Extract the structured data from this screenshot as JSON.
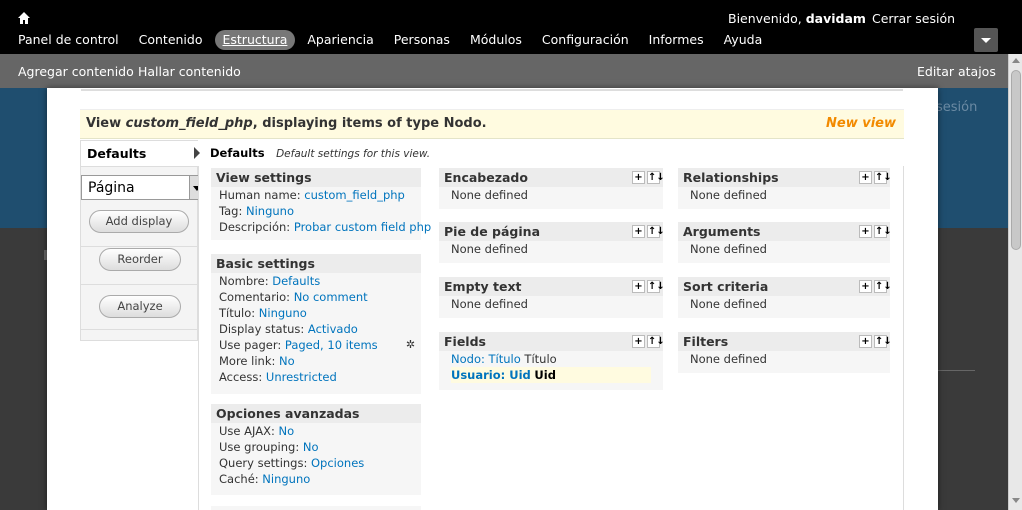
{
  "toolbar": {
    "menu": [
      "Panel de control",
      "Contenido",
      "Estructura",
      "Apariencia",
      "Personas",
      "Módulos",
      "Configuración",
      "Informes",
      "Ayuda"
    ],
    "welcome_prefix": "Bienvenido,",
    "username": "davidam",
    "logout": "Cerrar sesión"
  },
  "shortcuts": {
    "add": "Agregar contenido",
    "find": "Hallar contenido",
    "edit": "Editar atajos"
  },
  "background": {
    "right_text": "sesión"
  },
  "view_header": {
    "prefix": "View",
    "name": "custom_field_php",
    "suffix": ", displaying items of type Nodo.",
    "new_view": "New view"
  },
  "left": {
    "tab_defaults": "Defaults",
    "display_select": "Página",
    "add_display": "Add display",
    "reorder": "Reorder",
    "analyze": "Analyze"
  },
  "display_header": {
    "title": "Defaults",
    "desc": "Default settings for this view."
  },
  "view_settings": {
    "title": "View settings",
    "human_name_label": "Human name:",
    "human_name": "custom_field_php",
    "tag_label": "Tag:",
    "tag": "Ninguno",
    "desc_label": "Descripción:",
    "desc": "Probar custom field php"
  },
  "basic_settings": {
    "title": "Basic settings",
    "rows": [
      {
        "label": "Nombre:",
        "value": "Defaults"
      },
      {
        "label": "Comentario:",
        "value": "No comment"
      },
      {
        "label": "Título:",
        "value": "Ninguno"
      },
      {
        "label": "Display status:",
        "value": "Activado"
      },
      {
        "label": "Use pager:",
        "value": "Paged, 10 items"
      },
      {
        "label": "More link:",
        "value": "No"
      },
      {
        "label": "Access:",
        "value": "Unrestricted"
      }
    ]
  },
  "advanced": {
    "title": "Opciones avanzadas",
    "rows": [
      {
        "label": "Use AJAX:",
        "value": "No"
      },
      {
        "label": "Use grouping:",
        "value": "No"
      },
      {
        "label": "Query settings:",
        "value": "Opciones"
      },
      {
        "label": "Caché:",
        "value": "Ninguno"
      }
    ]
  },
  "middle": {
    "header": {
      "title": "Encabezado",
      "body": "None defined"
    },
    "footer": {
      "title": "Pie de página",
      "body": "None defined"
    },
    "empty": {
      "title": "Empty text",
      "body": "None defined"
    },
    "fields": {
      "title": "Fields",
      "field1_link": "Nodo: Título",
      "field1_label": "Título",
      "field2_link": "Usuario: Uid",
      "field2_label": "Uid"
    }
  },
  "right": {
    "relationships": {
      "title": "Relationships",
      "body": "None defined"
    },
    "arguments": {
      "title": "Arguments",
      "body": "None defined"
    },
    "sort": {
      "title": "Sort criteria",
      "body": "None defined"
    },
    "filters": {
      "title": "Filters",
      "body": "None defined"
    }
  },
  "icons": {
    "add": "+",
    "rearrange": "↑↓",
    "gear": "✲"
  }
}
